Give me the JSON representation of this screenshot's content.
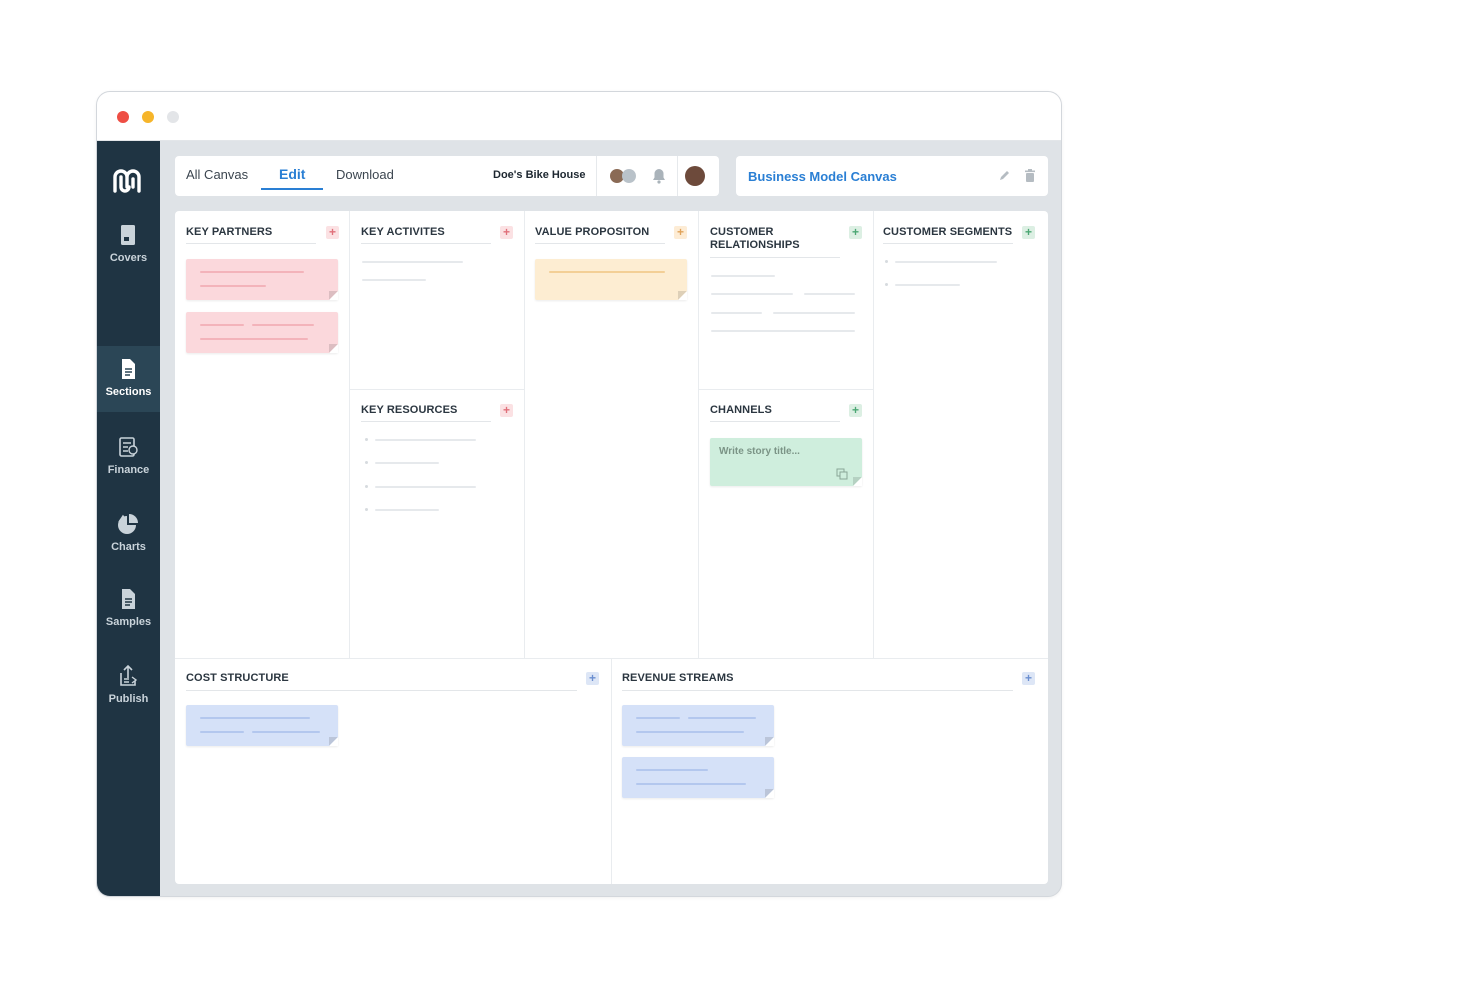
{
  "sidebar": {
    "items": [
      {
        "label": "Covers",
        "icon": "covers-icon"
      },
      {
        "label": "Sections",
        "icon": "document-icon",
        "active": true
      },
      {
        "label": "Finance",
        "icon": "finance-icon"
      },
      {
        "label": "Charts",
        "icon": "pie-chart-icon"
      },
      {
        "label": "Samples",
        "icon": "samples-icon"
      },
      {
        "label": "Publish",
        "icon": "publish-icon"
      }
    ]
  },
  "toolbar": {
    "tabs": [
      {
        "label": "All Canvas"
      },
      {
        "label": "Edit",
        "active": true
      },
      {
        "label": "Download"
      }
    ],
    "project_name": "Doe's Bike House"
  },
  "canvas": {
    "title": "Business Model Canvas"
  },
  "sections": {
    "key_partners": {
      "title": "KEY PARTNERS"
    },
    "key_activities": {
      "title": "KEY ACTIVITES"
    },
    "key_resources": {
      "title": "KEY RESOURCES"
    },
    "value_proposition": {
      "title": "VALUE PROPOSITON"
    },
    "customer_relationships": {
      "title": "CUSTOMER RELATIONSHIPS"
    },
    "channels": {
      "title": "CHANNELS",
      "story_placeholder": "Write story title..."
    },
    "customer_segments": {
      "title": "CUSTOMER SEGMENTS"
    },
    "cost_structure": {
      "title": "COST STRUCTURE"
    },
    "revenue_streams": {
      "title": "REVENUE STREAMS"
    }
  },
  "colors": {
    "accent": "#2a7fd4",
    "sidebar": "#1f3443",
    "note_pink": "#fbd8dc",
    "note_peach": "#fdedd2",
    "note_green": "#cfeedd",
    "note_blue": "#d5e1f8"
  }
}
